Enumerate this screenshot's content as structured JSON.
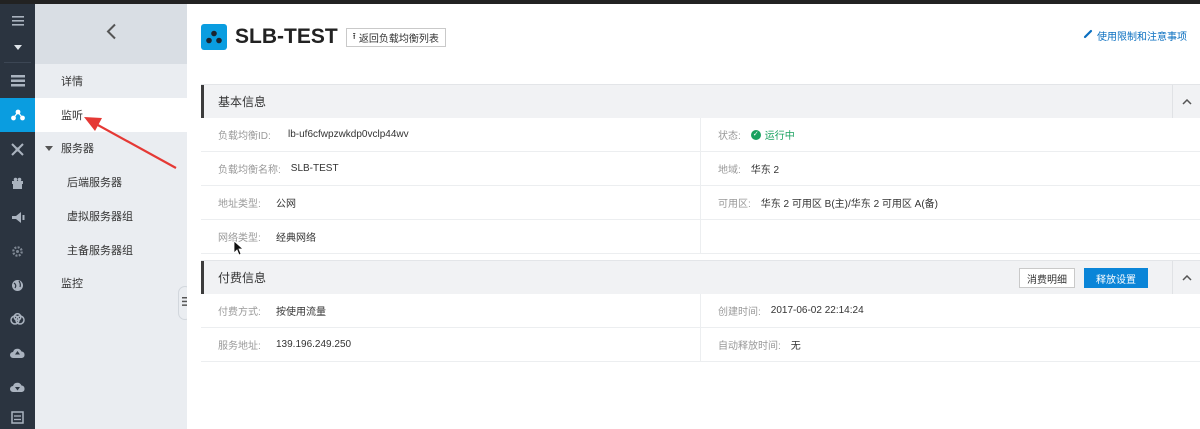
{
  "rail": {
    "icons": [
      "menu-icon",
      "dropdown-icon",
      "list-icon",
      "slb-icon",
      "network-icon",
      "gift-icon",
      "broadcast-icon",
      "settings-icon",
      "globe-icon",
      "cloud-link-icon",
      "cloud-up-icon",
      "cloud-down-icon",
      "console-icon"
    ]
  },
  "sidebar": {
    "items": [
      {
        "label": "详情"
      },
      {
        "label": "监听"
      },
      {
        "label": "服务器"
      },
      {
        "label": "后端服务器"
      },
      {
        "label": "虚拟服务器组"
      },
      {
        "label": "主备服务器组"
      },
      {
        "label": "监控"
      }
    ]
  },
  "header": {
    "title": "SLB-TEST",
    "back_label": "返回负载均衡列表",
    "help_label": "使用限制和注意事项"
  },
  "basic": {
    "title": "基本信息",
    "id_label": "负载均衡ID:",
    "id_value": "lb-uf6cfwpzwkdp0vclp44wv",
    "status_label": "状态:",
    "status_value": "运行中",
    "name_label": "负载均衡名称:",
    "name_value": "SLB-TEST",
    "region_label": "地域:",
    "region_value": "华东 2",
    "addr_type_label": "地址类型:",
    "addr_type_value": "公网",
    "zone_label": "可用区:",
    "zone_value": "华东 2 可用区 B(主)/华东 2 可用区 A(备)",
    "net_type_label": "网络类型:",
    "net_type_value": "经典网络"
  },
  "billing": {
    "title": "付费信息",
    "detail_btn": "消费明细",
    "release_btn": "释放设置",
    "pay_label": "付费方式:",
    "pay_value": "按使用流量",
    "created_label": "创建时间:",
    "created_value": "2017-06-02 22:14:24",
    "addr_label": "服务地址:",
    "addr_value": "139.196.249.250",
    "auto_release_label": "自动释放时间:",
    "auto_release_value": "无"
  },
  "colors": {
    "accent": "#0a9de0",
    "primary_button": "#0a85d8",
    "status_ok": "#19a15f",
    "rail_bg": "#2b3440",
    "arrow": "#e53935"
  }
}
